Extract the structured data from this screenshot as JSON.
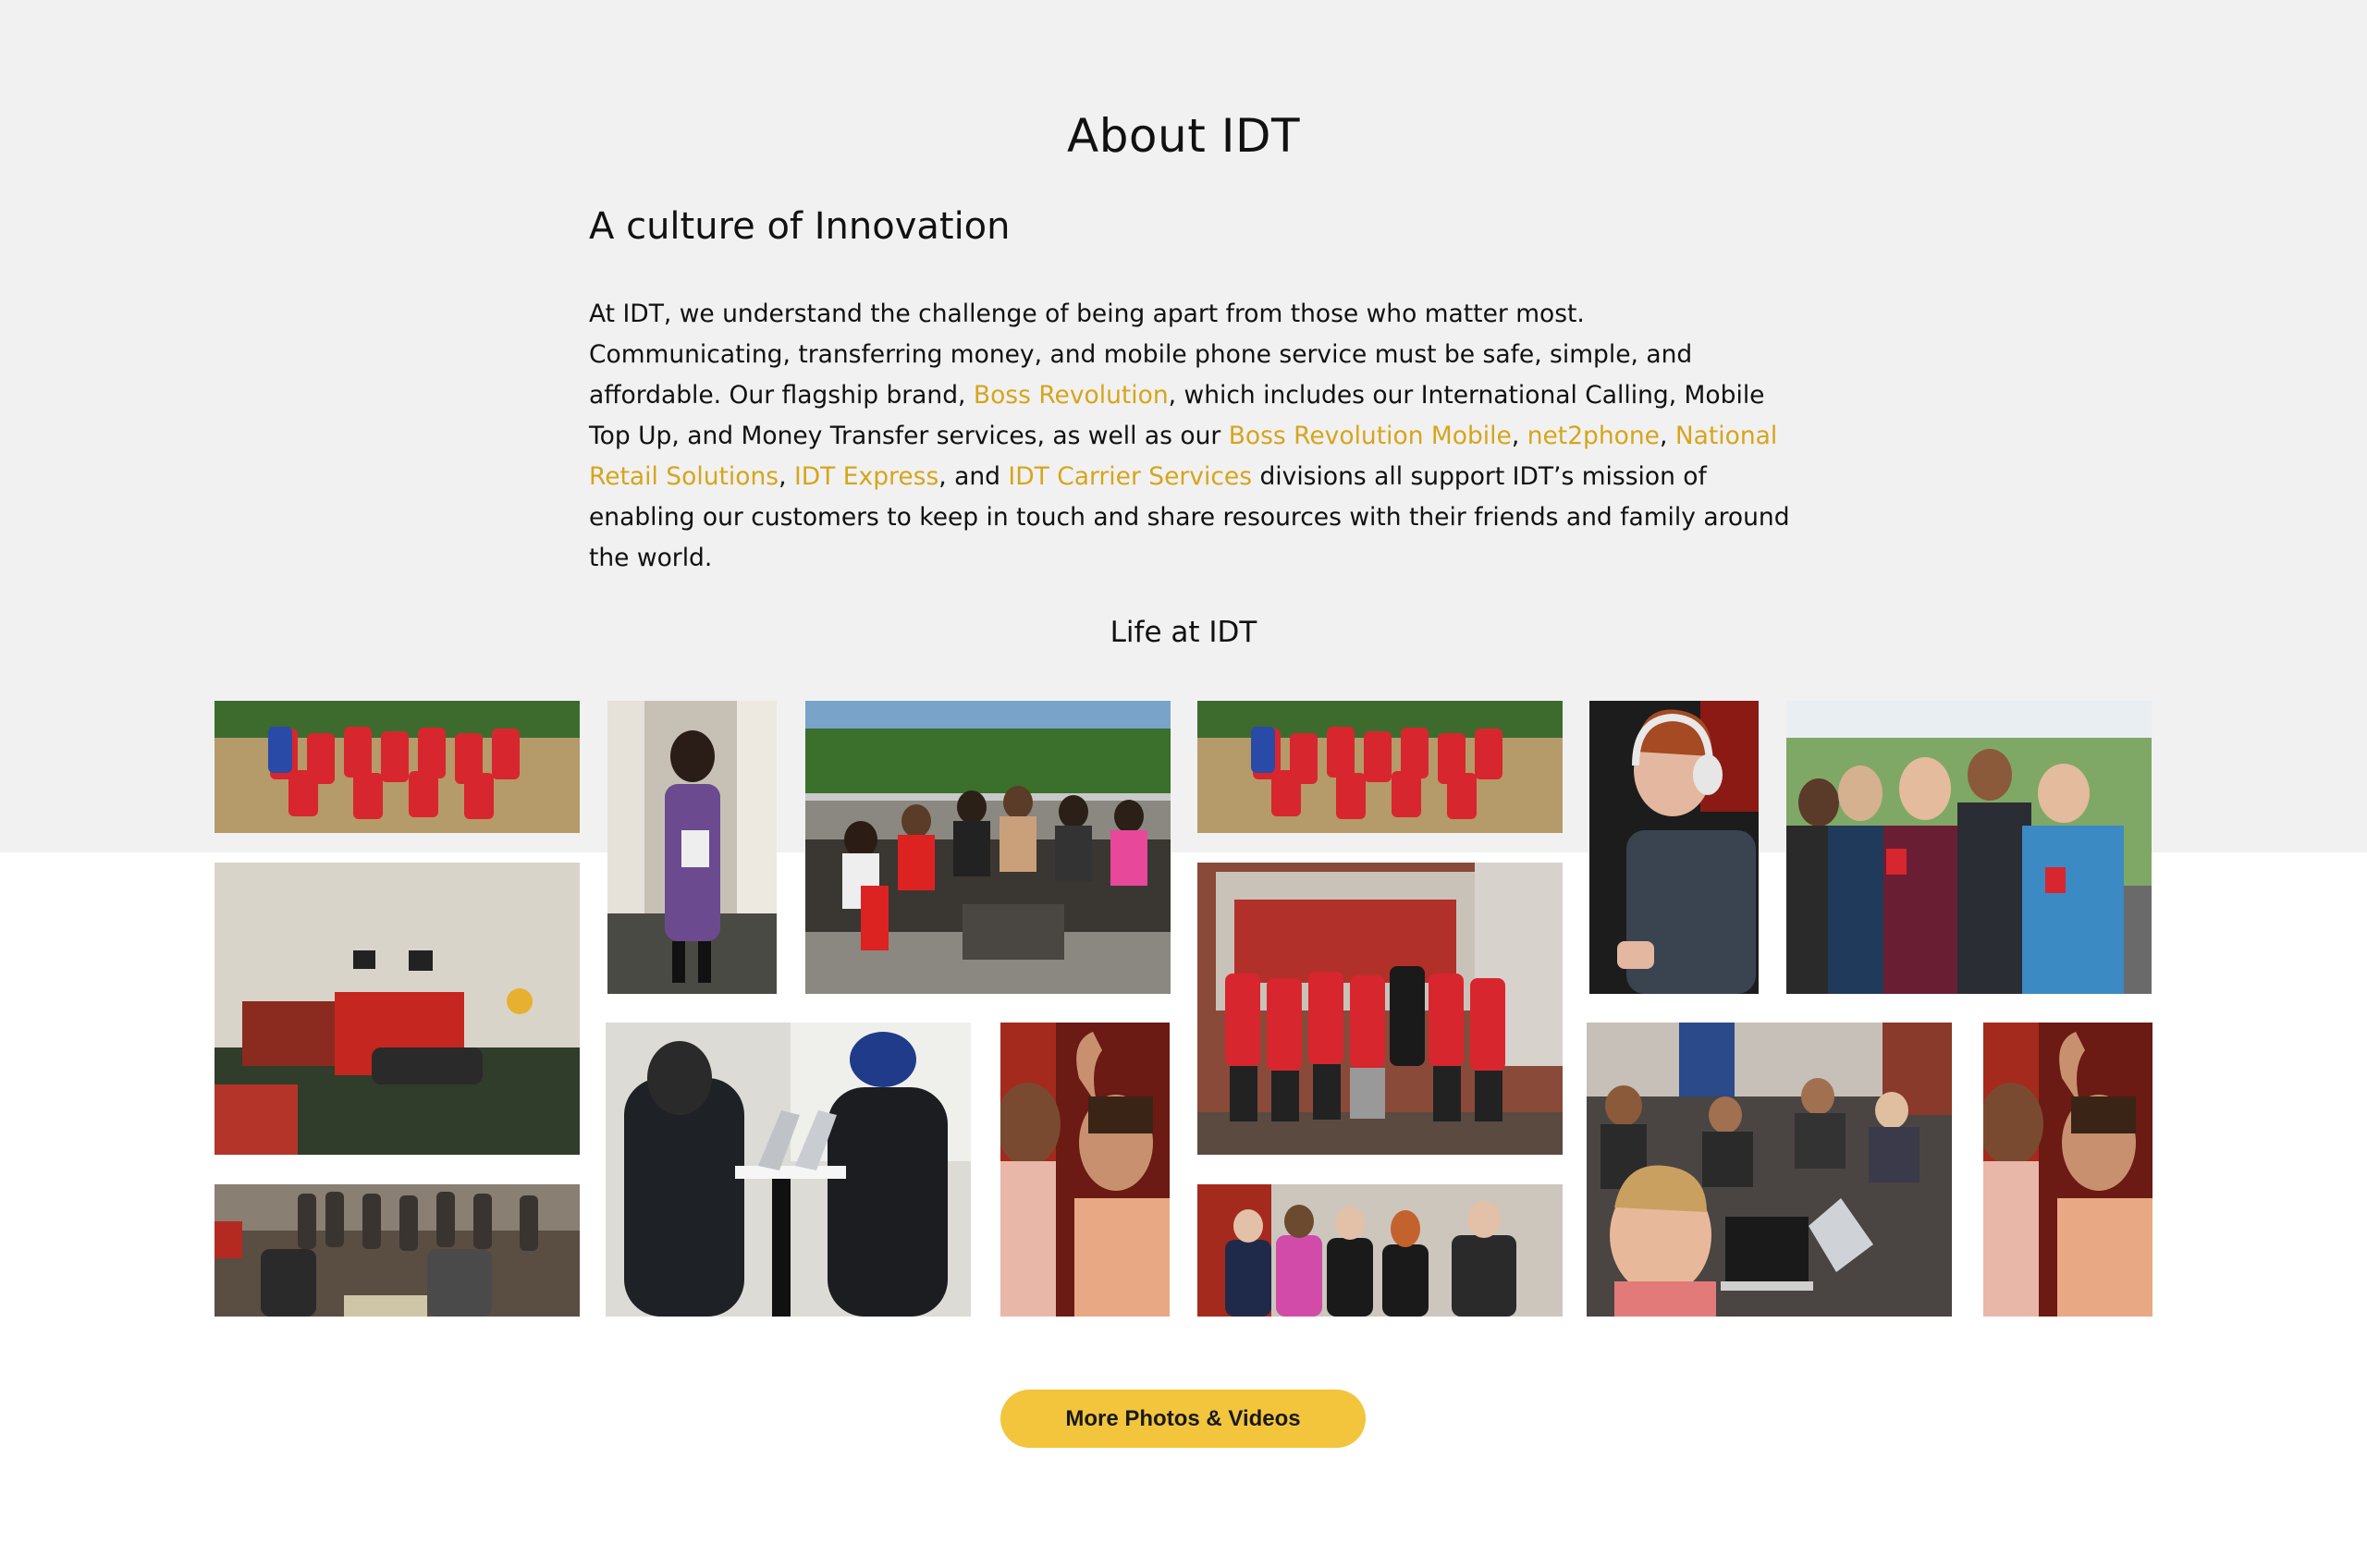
{
  "about": {
    "title": "About IDT",
    "subtitle": "A culture of Innovation",
    "p_1": "At IDT, we understand the challenge of being apart from those who matter most. Communicating, transferring money, and mobile phone service must be safe, simple, and affordable. Our flagship brand, ",
    "link_boss": "Boss Revolution",
    "p_2": ", which includes our International Calling, Mobile Top Up, and Money Transfer services, as well as our ",
    "link_boss_mobile": "Boss Revolution Mobile",
    "sep_1": ", ",
    "link_net2phone": "net2phone",
    "sep_2": ", ",
    "link_nrs": "National Retail Solutions",
    "sep_3": ", ",
    "link_express": "IDT Express",
    "sep_4": ", and ",
    "link_carrier": "IDT Carrier Services",
    "p_3": " divisions all support IDT’s mission of enabling our customers to keep in touch and share resources with their friends and family around the world."
  },
  "life": {
    "title": "Life at IDT",
    "more_button": "More Photos & Videos"
  },
  "colors": {
    "link": "#d6a51c",
    "button": "#f2c53d",
    "band": "#f1f1f1"
  }
}
